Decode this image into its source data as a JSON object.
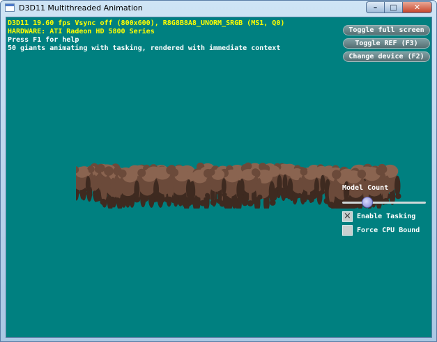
{
  "window": {
    "title": "D3D11 Multithreaded Animation",
    "caption_buttons": {
      "minimize_glyph": "–",
      "maximize_glyph": "□",
      "close_glyph": "✕"
    }
  },
  "hud": {
    "lines": [
      "D3D11 19.60 fps Vsync off (800x600), R8G8B8A8_UNORM_SRGB (MS1, Q0)",
      "HARDWARE: ATI Radeon HD 5800 Series",
      "Press F1 for help",
      "50 giants animating with tasking, rendered with immediate context"
    ]
  },
  "buttons": {
    "toggle_full_screen": "Toggle full screen",
    "toggle_ref": "Toggle REF (F3)",
    "change_device": "Change device (F2)"
  },
  "scene": {
    "giant_count": 50,
    "colors": {
      "background": "#008080",
      "giant_body": "#6b4a3a",
      "giant_shadow": "#3e2a20",
      "giant_highlight": "#8a6450"
    }
  },
  "controls": {
    "model_count": {
      "label": "Model Count",
      "value_fraction": 0.3
    },
    "enable_tasking": {
      "label": "Enable Tasking",
      "checked": true
    },
    "force_cpu_bound": {
      "label": "Force CPU Bound",
      "checked": false
    }
  }
}
